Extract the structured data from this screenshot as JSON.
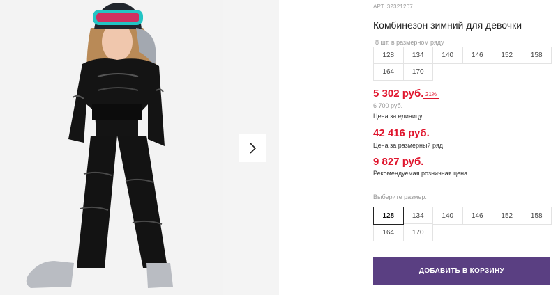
{
  "product": {
    "article": "АРТ. 32321207",
    "title": "Комбинезон зимний для девочки"
  },
  "pack": {
    "label": "8 шт. в размерном ряду",
    "sizes": [
      "128",
      "134",
      "140",
      "146",
      "152",
      "158",
      "164",
      "170"
    ]
  },
  "prices": {
    "unit_price": "5 302 руб.",
    "discount": "21%",
    "old_price": "6 700 руб.",
    "unit_caption": "Цена за единицу",
    "pack_price": "42 416 руб.",
    "pack_caption": "Цена за размерный ряд",
    "retail_price": "9 827 руб.",
    "retail_caption": "Рекомендуемая розничная цена"
  },
  "select_size": {
    "label": "Выберите размер:",
    "sizes": [
      "128",
      "134",
      "140",
      "146",
      "152",
      "158",
      "164",
      "170"
    ],
    "selected": "128"
  },
  "cart": {
    "add_label": "ДОБАВИТЬ В КОРЗИНУ"
  },
  "colors": {
    "accent_red": "#e0152d",
    "button_purple": "#5a3f82"
  },
  "icons": {
    "gallery_next": "chevron-right-icon"
  }
}
